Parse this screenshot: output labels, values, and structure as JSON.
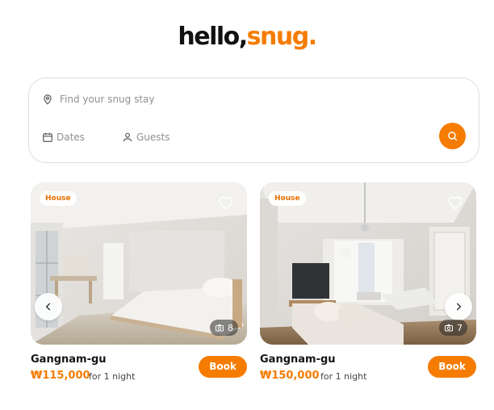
{
  "brand": {
    "part1": "hello,",
    "part2": "snug.",
    "accent_color": "#f57c00"
  },
  "search": {
    "location_placeholder": "Find your snug stay",
    "dates_label": "Dates",
    "guests_label": "Guests",
    "location_icon": "map-pin-icon",
    "dates_icon": "calendar-icon",
    "guests_icon": "user-icon",
    "button_icon": "search-icon"
  },
  "listings": [
    {
      "badge": "House",
      "location": "Gangnam-gu",
      "price": "₩115,000",
      "per": "for 1 night",
      "photo_count": "8",
      "book_label": "Book",
      "has_prev": true,
      "has_next": false
    },
    {
      "badge": "House",
      "location": "Gangnam-gu",
      "price": "₩150,000",
      "per": "for 1 night",
      "photo_count": "7",
      "book_label": "Book",
      "has_prev": false,
      "has_next": true
    }
  ]
}
